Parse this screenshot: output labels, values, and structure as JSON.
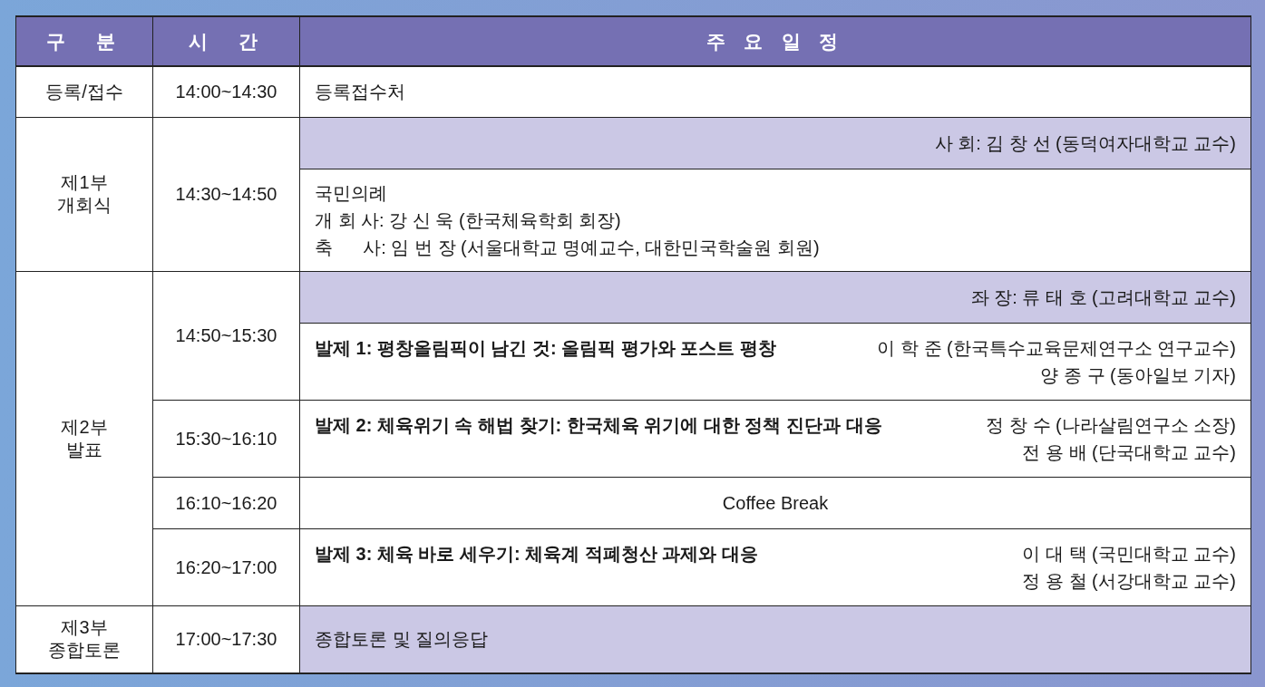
{
  "header": [
    "구  분",
    "시  간",
    "주 요 일 정"
  ],
  "sections": [
    {
      "category": [
        "등록/접수"
      ],
      "slots": [
        {
          "time": "14:00~14:30",
          "items": [
            {
              "kind": "lines",
              "shaded": false,
              "lines": [
                "등록접수처"
              ]
            }
          ]
        }
      ]
    },
    {
      "category": [
        "제1부",
        "개회식"
      ],
      "slots": [
        {
          "time": "14:30~14:50",
          "items": [
            {
              "kind": "host",
              "text": "사 회: 김 창 선 (동덕여자대학교 교수)"
            },
            {
              "kind": "lines",
              "shaded": false,
              "lines": [
                "국민의례",
                "개 회 사: 강 신 욱 (한국체육학회 회장)",
                "축      사: 임 번 장 (서울대학교 명예교수, 대한민국학술원 회원)"
              ]
            }
          ]
        }
      ]
    },
    {
      "category": [
        "제2부",
        "발표"
      ],
      "slots": [
        {
          "time": "14:50~15:30",
          "items": [
            {
              "kind": "host",
              "text": "좌 장: 류 태 호 (고려대학교 교수)"
            },
            {
              "kind": "talk",
              "title": "발제 1: 평창올림픽이 남긴 것: 올림픽 평가와 포스트 평창",
              "speakers": [
                "이 학 준 (한국특수교육문제연구소 연구교수)",
                "양 종 구 (동아일보 기자)"
              ]
            }
          ]
        },
        {
          "time": "15:30~16:10",
          "items": [
            {
              "kind": "talk",
              "title": "발제 2: 체육위기 속 해법 찾기: 한국체육 위기에 대한 정책 진단과 대응",
              "speakers": [
                "정 창 수 (나라살림연구소 소장)",
                "전 용 배 (단국대학교 교수)"
              ]
            }
          ]
        },
        {
          "time": "16:10~16:20",
          "items": [
            {
              "kind": "break",
              "text": "Coffee Break"
            }
          ]
        },
        {
          "time": "16:20~17:00",
          "items": [
            {
              "kind": "talk",
              "title": "발제 3: 체육 바로 세우기: 체육계 적폐청산 과제와 대응",
              "speakers": [
                "이 대 택 (국민대학교 교수)",
                "정 용 철 (서강대학교 교수)"
              ]
            }
          ]
        }
      ]
    },
    {
      "category": [
        "제3부",
        "종합토론"
      ],
      "slots": [
        {
          "time": "17:00~17:30",
          "items": [
            {
              "kind": "lines",
              "shaded": true,
              "lines": [
                "종합토론 및 질의응답"
              ]
            }
          ]
        }
      ]
    }
  ]
}
